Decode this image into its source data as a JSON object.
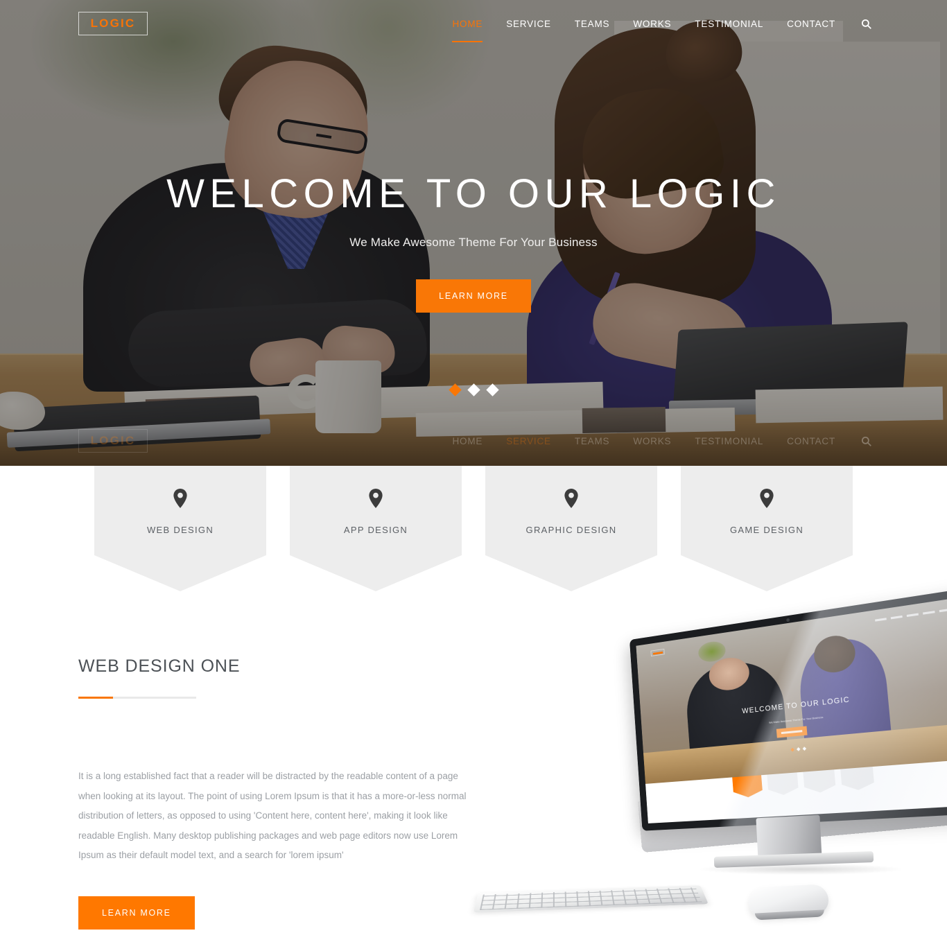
{
  "brand": {
    "logo_text": "LOGIC",
    "accent_color": "#f97706",
    "button_color": "#ff7800"
  },
  "header": {
    "nav": [
      {
        "label": "HOME",
        "active": true
      },
      {
        "label": "SERVICE",
        "active": false
      },
      {
        "label": "TEAMS",
        "active": false
      },
      {
        "label": "WORKS",
        "active": false
      },
      {
        "label": "TESTIMONIAL",
        "active": false
      },
      {
        "label": "CONTACT",
        "active": false
      }
    ],
    "search_icon": "search-icon"
  },
  "hero": {
    "title": "WELCOME TO OUR LOGIC",
    "subtitle": "We Make Awesome Theme For Your Business",
    "cta_label": "LEARN MORE",
    "carousel": {
      "total": 3,
      "active_index": 0
    }
  },
  "services": [
    {
      "label": "WEB DESIGN",
      "icon": "map-pin-icon"
    },
    {
      "label": "APP DESIGN",
      "icon": "map-pin-icon"
    },
    {
      "label": "GRAPHIC DESIGN",
      "icon": "map-pin-icon"
    },
    {
      "label": "GAME DESIGN",
      "icon": "map-pin-icon"
    }
  ],
  "section_one": {
    "title": "WEB DESIGN ONE",
    "paragraph": "It is a long established fact that a reader will be distracted by the readable content of a page when looking at its layout. The point of using Lorem Ipsum is that it has a more-or-less normal distribution of letters, as opposed to using 'Content here, content here', making it look like readable English. Many desktop publishing packages and web page editors now use Lorem Ipsum as their default model text, and a search for 'lorem ipsum'",
    "cta_label": "LEARN MORE",
    "mockup": {
      "title": "WELCOME TO OUR LOGIC",
      "subtitle": "We Make Awesome Theme For Your Business"
    }
  }
}
